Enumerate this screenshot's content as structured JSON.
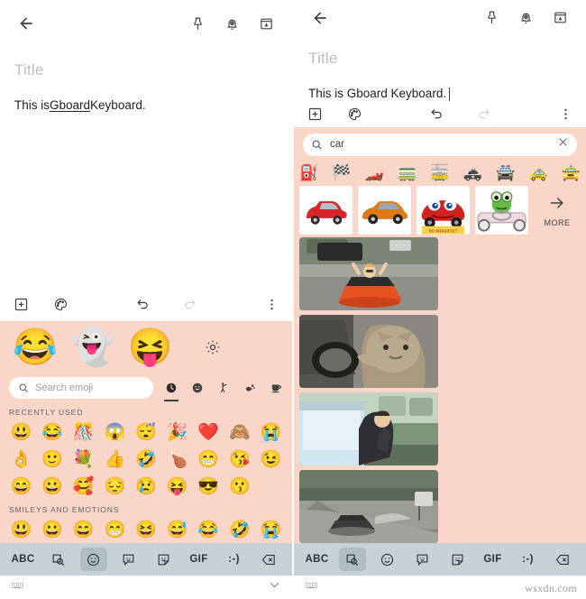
{
  "left": {
    "appbar": {
      "back": "back-arrow",
      "actions": [
        "pin",
        "reminder-bell",
        "archive"
      ]
    },
    "note": {
      "title_placeholder": "Title",
      "text_before": "This is ",
      "text_underlined": "Gboard",
      "text_after": " Keyboard.",
      "caret_visible": false
    },
    "toolbar": {
      "add": "plus-box-icon",
      "palette": "palette-icon",
      "undo": "undo-icon",
      "redo": "redo-icon",
      "overflow": "more-vert-icon"
    },
    "keyboard": {
      "stickers": [
        "😂",
        "👻",
        "😝"
      ],
      "settings_icon": "gear-icon",
      "search_placeholder": "Search emoji",
      "categories": [
        {
          "name": "recent",
          "glyph": "clock",
          "active": true
        },
        {
          "name": "smileys",
          "glyph": "smiley",
          "active": false
        },
        {
          "name": "people",
          "glyph": "person",
          "active": false
        },
        {
          "name": "nature",
          "glyph": "nature",
          "active": false
        },
        {
          "name": "food",
          "glyph": "food",
          "active": false
        }
      ],
      "section_recent": "RECENTLY USED",
      "recent_emojis": [
        "😃",
        "😂",
        "🎊",
        "😱",
        "😴",
        "🎉",
        "❤️",
        "🙈",
        "😭",
        "👌",
        "🙂",
        "💐",
        "👍",
        "🤣",
        "🍗",
        "😁",
        "😘",
        "😉",
        "😄",
        "😀",
        "🥰",
        "😔",
        "😢",
        "😝",
        "😎",
        "😗"
      ],
      "section_smileys": "SMILEYS AND EMOTIONS",
      "smiley_emojis": [
        "😃",
        "😀",
        "😄",
        "😁",
        "😆",
        "😅",
        "😂",
        "🤣",
        "😭"
      ],
      "keys": [
        {
          "name": "abc-key",
          "label": "ABC",
          "type": "text",
          "selected": false
        },
        {
          "name": "sticker-search-key",
          "label": "",
          "type": "sticker-search-icon",
          "selected": false
        },
        {
          "name": "emoji-key",
          "label": "",
          "type": "emoji-icon",
          "selected": true
        },
        {
          "name": "emoticon-key",
          "label": "",
          "type": "emoticon-icon",
          "selected": false
        },
        {
          "name": "sticker-key",
          "label": "",
          "type": "sticker-icon",
          "selected": false
        },
        {
          "name": "gif-key",
          "label": "GIF",
          "type": "text",
          "selected": false
        },
        {
          "name": "kaomoji-key",
          "label": ":-)",
          "type": "text",
          "selected": false
        },
        {
          "name": "backspace-key",
          "label": "",
          "type": "backspace-icon",
          "selected": false
        }
      ],
      "navbar": {
        "keyboard_icon": "keyboard-icon",
        "collapse_icon": "chevron-down-icon"
      }
    }
  },
  "right": {
    "appbar": {
      "back": "back-arrow",
      "actions": [
        "pin",
        "reminder-bell",
        "archive"
      ]
    },
    "note": {
      "title_placeholder": "Title",
      "text_before": "This is Gboard Keyboard.",
      "text_underlined": "",
      "text_after": "",
      "caret_visible": true
    },
    "toolbar": {
      "add": "plus-box-icon",
      "palette": "palette-icon",
      "undo": "undo-icon",
      "redo": "redo-icon",
      "overflow": "more-vert-icon"
    },
    "keyboard": {
      "search_value": "car",
      "search_clear": "close-icon",
      "suggest_emojis": [
        "⛽",
        "🏁",
        "🏎️",
        "🚃",
        "🚋",
        "🚓",
        "🚔",
        "🚕",
        "🚖"
      ],
      "sticker_results": [
        "red-hatchback-car",
        "orange-suv-car",
        "lightning-mcqueen-car",
        "frog-driving-car"
      ],
      "more_label": "MORE",
      "more_icon": "arrow-right-icon",
      "gif_results": [
        "woman-in-red-convertible",
        "cat-driving-car",
        "man-leaning-out-car-window",
        "car-drifting-on-road"
      ],
      "keys": [
        {
          "name": "abc-key",
          "label": "ABC",
          "type": "text",
          "selected": false
        },
        {
          "name": "sticker-search-key",
          "label": "",
          "type": "sticker-search-icon",
          "selected": true
        },
        {
          "name": "emoji-key",
          "label": "",
          "type": "emoji-icon",
          "selected": false
        },
        {
          "name": "emoticon-key",
          "label": "",
          "type": "emoticon-icon",
          "selected": false
        },
        {
          "name": "sticker-key",
          "label": "",
          "type": "sticker-icon",
          "selected": false
        },
        {
          "name": "gif-key",
          "label": "GIF",
          "type": "text",
          "selected": false
        },
        {
          "name": "kaomoji-key",
          "label": ":-)",
          "type": "text",
          "selected": false
        },
        {
          "name": "backspace-key",
          "label": "",
          "type": "backspace-icon",
          "selected": false
        }
      ],
      "navbar": {
        "keyboard_icon": "keyboard-icon",
        "collapse_icon": ""
      }
    }
  },
  "watermark": "wsxdn.com",
  "colors": {
    "keyboard_bg": "#f9d6c8",
    "keyrow_bg": "#c6d2d5",
    "key_selected": "#b0bec2",
    "text_primary": "#202124",
    "text_muted": "#9aa0a6"
  }
}
